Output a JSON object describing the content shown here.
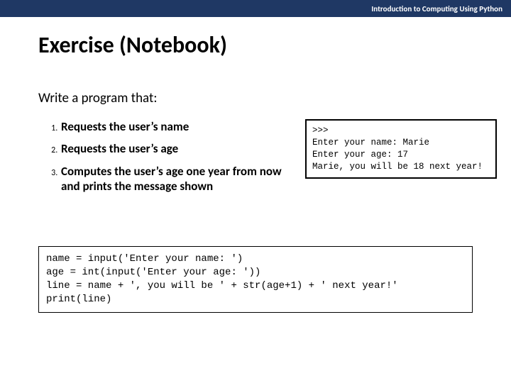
{
  "header": {
    "course": "Introduction to Computing Using Python"
  },
  "title": "Exercise (Notebook)",
  "prompt": "Write a program that:",
  "steps": [
    "Requests the user’s name",
    "Requests the user’s age",
    "Computes the user’s age one year from now and prints the message shown"
  ],
  "terminal": ">>>\nEnter your name: Marie\nEnter your age: 17\nMarie, you will be 18 next year!",
  "code": "name = input('Enter your name: ')\nage = int(input('Enter your age: '))\nline = name + ', you will be ' + str(age+1) + ' next year!'\nprint(line)"
}
